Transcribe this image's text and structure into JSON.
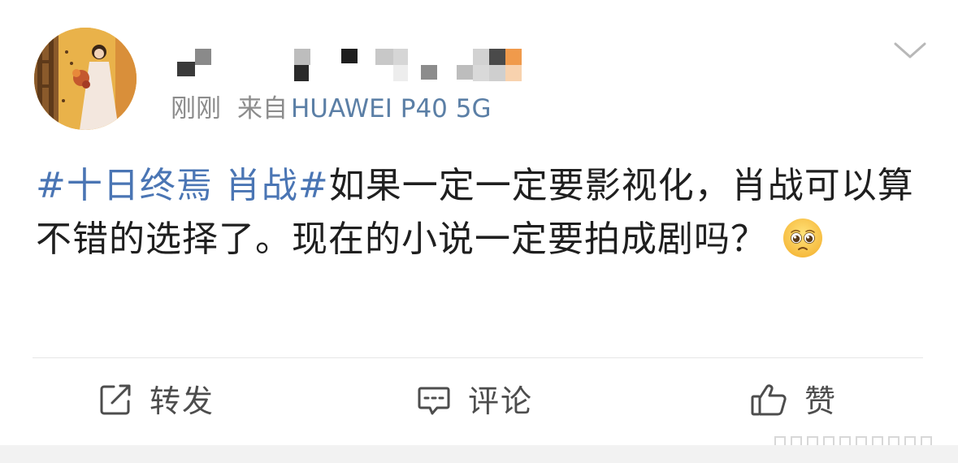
{
  "post": {
    "time": "刚刚",
    "source_prefix": "来自",
    "device": "HUAWEI P40 5G",
    "hashtag": "#十日终焉 肖战#",
    "body": "如果一定一定要影视化，肖战可以算不错的选择了。现在的小说一定要拍成剧吗？"
  },
  "actions": {
    "repost": "转发",
    "comment": "评论",
    "like": "赞"
  },
  "icons": {
    "repost": "repost-edit-icon",
    "comment": "comment-bubble-icon",
    "like": "thumbs-up-icon",
    "more": "chevron-down-icon",
    "emoji": "pleading-face-emoji"
  },
  "colors": {
    "hashtag": "#4a75b4",
    "device": "#5b7fa6",
    "meta": "#8c8c8c",
    "text": "#1f1f1f"
  }
}
